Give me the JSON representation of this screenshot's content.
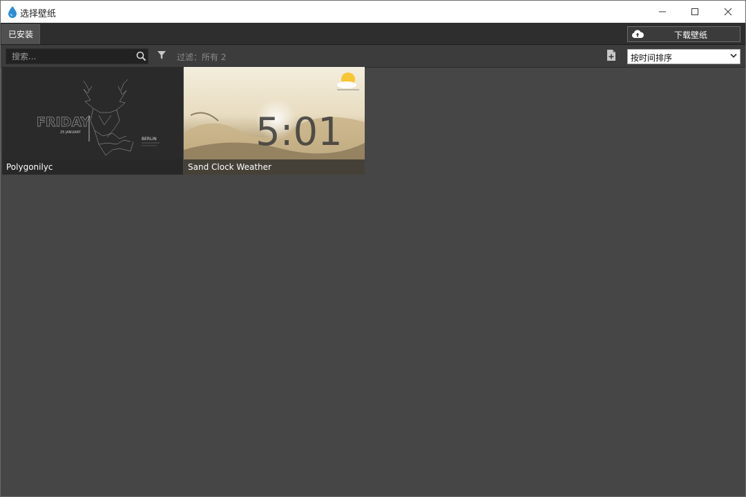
{
  "window": {
    "title": "选择壁纸"
  },
  "tabs": [
    {
      "label": "已安装",
      "active": true
    }
  ],
  "header": {
    "download_label": "下载壁纸"
  },
  "toolbar": {
    "search_placeholder": "搜索...",
    "filter_text": "过滤：所有 2",
    "sort_value": "按时间排序"
  },
  "wallpapers": [
    {
      "name": "Polygonilyc",
      "selected": true,
      "art_text": {
        "day": "FRIDAY",
        "date": "25 JANUARY",
        "city": "BERLIN"
      }
    },
    {
      "name": "Sand Clock Weather",
      "selected": false,
      "art_text": {
        "time": "5:01"
      }
    }
  ],
  "colors": {
    "accent": "#1e7fc8",
    "background": "#464646",
    "tabbar": "#2e2e2e",
    "toolbar": "#3c3c3c"
  },
  "icons": [
    "app-drop-icon",
    "minimize-icon",
    "maximize-icon",
    "close-icon",
    "cloud-upload-icon",
    "search-icon",
    "filter-icon",
    "add-file-icon",
    "chevron-down-icon",
    "weather-sun-icon"
  ]
}
